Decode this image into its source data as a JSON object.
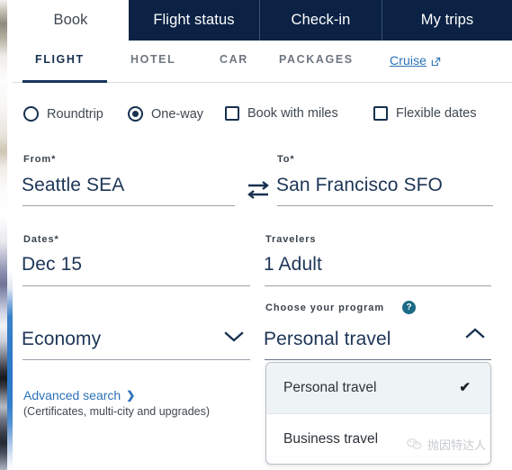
{
  "top_tabs": [
    {
      "label": "Book",
      "active": true
    },
    {
      "label": "Flight status",
      "active": false
    },
    {
      "label": "Check-in",
      "active": false
    },
    {
      "label": "My trips",
      "active": false
    }
  ],
  "sub_tabs": [
    {
      "label": "FLIGHT",
      "active": true
    },
    {
      "label": "HOTEL",
      "active": false
    },
    {
      "label": "CAR",
      "active": false
    },
    {
      "label": "PACKAGES",
      "active": false
    }
  ],
  "cruise_link": {
    "label": "Cruise",
    "icon": "external-link-icon"
  },
  "trip_options": [
    {
      "label": "Roundtrip",
      "type": "radio",
      "selected": false
    },
    {
      "label": "One-way",
      "type": "radio",
      "selected": true
    },
    {
      "label": "Book with miles",
      "type": "checkbox",
      "selected": false
    },
    {
      "label": "Flexible dates",
      "type": "checkbox",
      "selected": false
    }
  ],
  "fields": {
    "from": {
      "label": "From*",
      "value": "Seattle SEA"
    },
    "to": {
      "label": "To*",
      "value": "San Francisco SFO"
    },
    "swap_icon": "swap-arrows-icon",
    "dates": {
      "label": "Dates*",
      "value": "Dec 15"
    },
    "travelers": {
      "label": "Travelers",
      "value": "1 Adult"
    },
    "cabin": {
      "value": "Economy",
      "icon": "chevron-down-icon"
    },
    "program": {
      "label": "Choose your program",
      "help_icon": "help-question-icon",
      "help_glyph": "?",
      "value": "Personal travel",
      "icon": "chevron-up-icon"
    }
  },
  "dropdown": {
    "options": [
      {
        "label": "Personal travel",
        "selected": true,
        "check_glyph": "✔"
      },
      {
        "label": "Business travel",
        "selected": false,
        "check_glyph": ""
      }
    ]
  },
  "advanced_search": {
    "label": "Advanced search",
    "chevron": "❯",
    "subtext": "(Certificates, multi-city and upgrades)"
  },
  "watermark": {
    "text": "抛因特达人"
  },
  "colors": {
    "navy": "#0b2244",
    "navy_text": "#16304f",
    "link_blue": "#2a71b8",
    "teal": "#1b6a86",
    "value_blue": "#1d3557"
  }
}
